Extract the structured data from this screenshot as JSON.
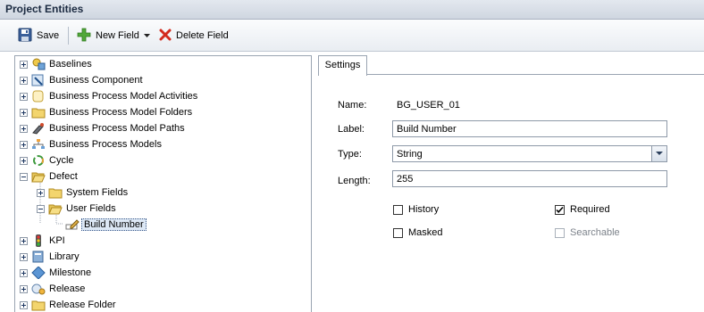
{
  "window": {
    "title": "Project Entities"
  },
  "toolbar": {
    "save_label": "Save",
    "new_field_label": "New Field",
    "delete_field_label": "Delete Field"
  },
  "tree": {
    "items": [
      {
        "label": "Baselines",
        "expander": "plus",
        "icon": "baseline-icon"
      },
      {
        "label": "Business Component",
        "expander": "plus",
        "icon": "business-component-icon"
      },
      {
        "label": "Business Process Model Activities",
        "expander": "plus",
        "icon": "activity-icon"
      },
      {
        "label": "Business Process Model Folders",
        "expander": "plus",
        "icon": "folder-icon"
      },
      {
        "label": "Business Process Model Paths",
        "expander": "plus",
        "icon": "path-icon"
      },
      {
        "label": "Business Process Models",
        "expander": "plus",
        "icon": "model-icon"
      },
      {
        "label": "Cycle",
        "expander": "plus",
        "icon": "cycle-icon"
      },
      {
        "label": "Defect",
        "expander": "minus",
        "icon": "folder-open-icon"
      },
      {
        "label": "System Fields",
        "expander": "plus",
        "icon": "folder-icon"
      },
      {
        "label": "User Fields",
        "expander": "minus",
        "icon": "folder-open-icon"
      },
      {
        "label": "Build Number",
        "expander": "none",
        "icon": "field-edit-icon",
        "selected": true
      },
      {
        "label": "KPI",
        "expander": "plus",
        "icon": "kpi-icon"
      },
      {
        "label": "Library",
        "expander": "plus",
        "icon": "library-icon"
      },
      {
        "label": "Milestone",
        "expander": "plus",
        "icon": "milestone-icon"
      },
      {
        "label": "Release",
        "expander": "plus",
        "icon": "release-icon"
      },
      {
        "label": "Release Folder",
        "expander": "plus",
        "icon": "folder-icon"
      }
    ]
  },
  "settings": {
    "tab_label": "Settings",
    "name_label": "Name:",
    "name_value": "BG_USER_01",
    "label_label": "Label:",
    "label_value": "Build Number",
    "type_label": "Type:",
    "type_value": "String",
    "length_label": "Length:",
    "length_value": "255",
    "history_label": "History",
    "history_checked": false,
    "required_label": "Required",
    "required_checked": true,
    "masked_label": "Masked",
    "masked_checked": false,
    "searchable_label": "Searchable",
    "searchable_checked": false,
    "searchable_disabled": true
  }
}
